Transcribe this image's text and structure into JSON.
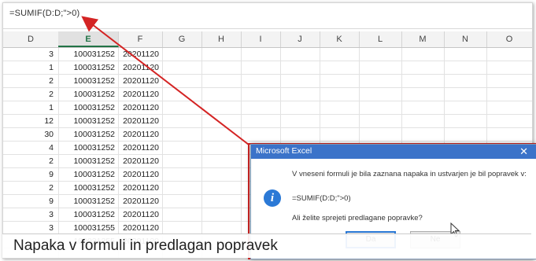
{
  "formula_bar": {
    "formula": "=SUMIF(D:D;\">0)"
  },
  "columns": [
    "D",
    "E",
    "F",
    "G",
    "H",
    "I",
    "J",
    "K",
    "L",
    "M",
    "N",
    "O"
  ],
  "rows": [
    {
      "d": "3",
      "e": "100031252",
      "f": "20201120"
    },
    {
      "d": "1",
      "e": "100031252",
      "f": "20201120"
    },
    {
      "d": "2",
      "e": "100031252",
      "f": "20201120"
    },
    {
      "d": "2",
      "e": "100031252",
      "f": "20201120"
    },
    {
      "d": "1",
      "e": "100031252",
      "f": "20201120"
    },
    {
      "d": "12",
      "e": "100031252",
      "f": "20201120"
    },
    {
      "d": "30",
      "e": "100031252",
      "f": "20201120"
    },
    {
      "d": "4",
      "e": "100031252",
      "f": "20201120"
    },
    {
      "d": "2",
      "e": "100031252",
      "f": "20201120"
    },
    {
      "d": "9",
      "e": "100031252",
      "f": "20201120"
    },
    {
      "d": "2",
      "e": "100031252",
      "f": "20201120"
    },
    {
      "d": "9",
      "e": "100031252",
      "f": "20201120"
    },
    {
      "d": "3",
      "e": "100031252",
      "f": "20201120"
    },
    {
      "d": "3",
      "e": "100031255",
      "f": "20201120"
    },
    {
      "d": "1",
      "e": "100031255",
      "f": "20201120"
    }
  ],
  "dialog": {
    "title": "Microsoft Excel",
    "close": "✕",
    "message": "V vneseni formuli je bila zaznana napaka in ustvarjen je bil popravek v:",
    "corrected_formula": "=SUMIF(D:D;\">0)",
    "question": "Ali želite sprejeti predlagane popravke?",
    "icon_glyph": "i",
    "yes_label": "Da",
    "no_label": "Ne"
  },
  "caption": "Napaka v formuli in predlagan popravek",
  "colors": {
    "accent_green": "#217346",
    "dialog_title": "#3b73c9",
    "highlight_red": "#d42424",
    "info_blue": "#2b79d6"
  }
}
